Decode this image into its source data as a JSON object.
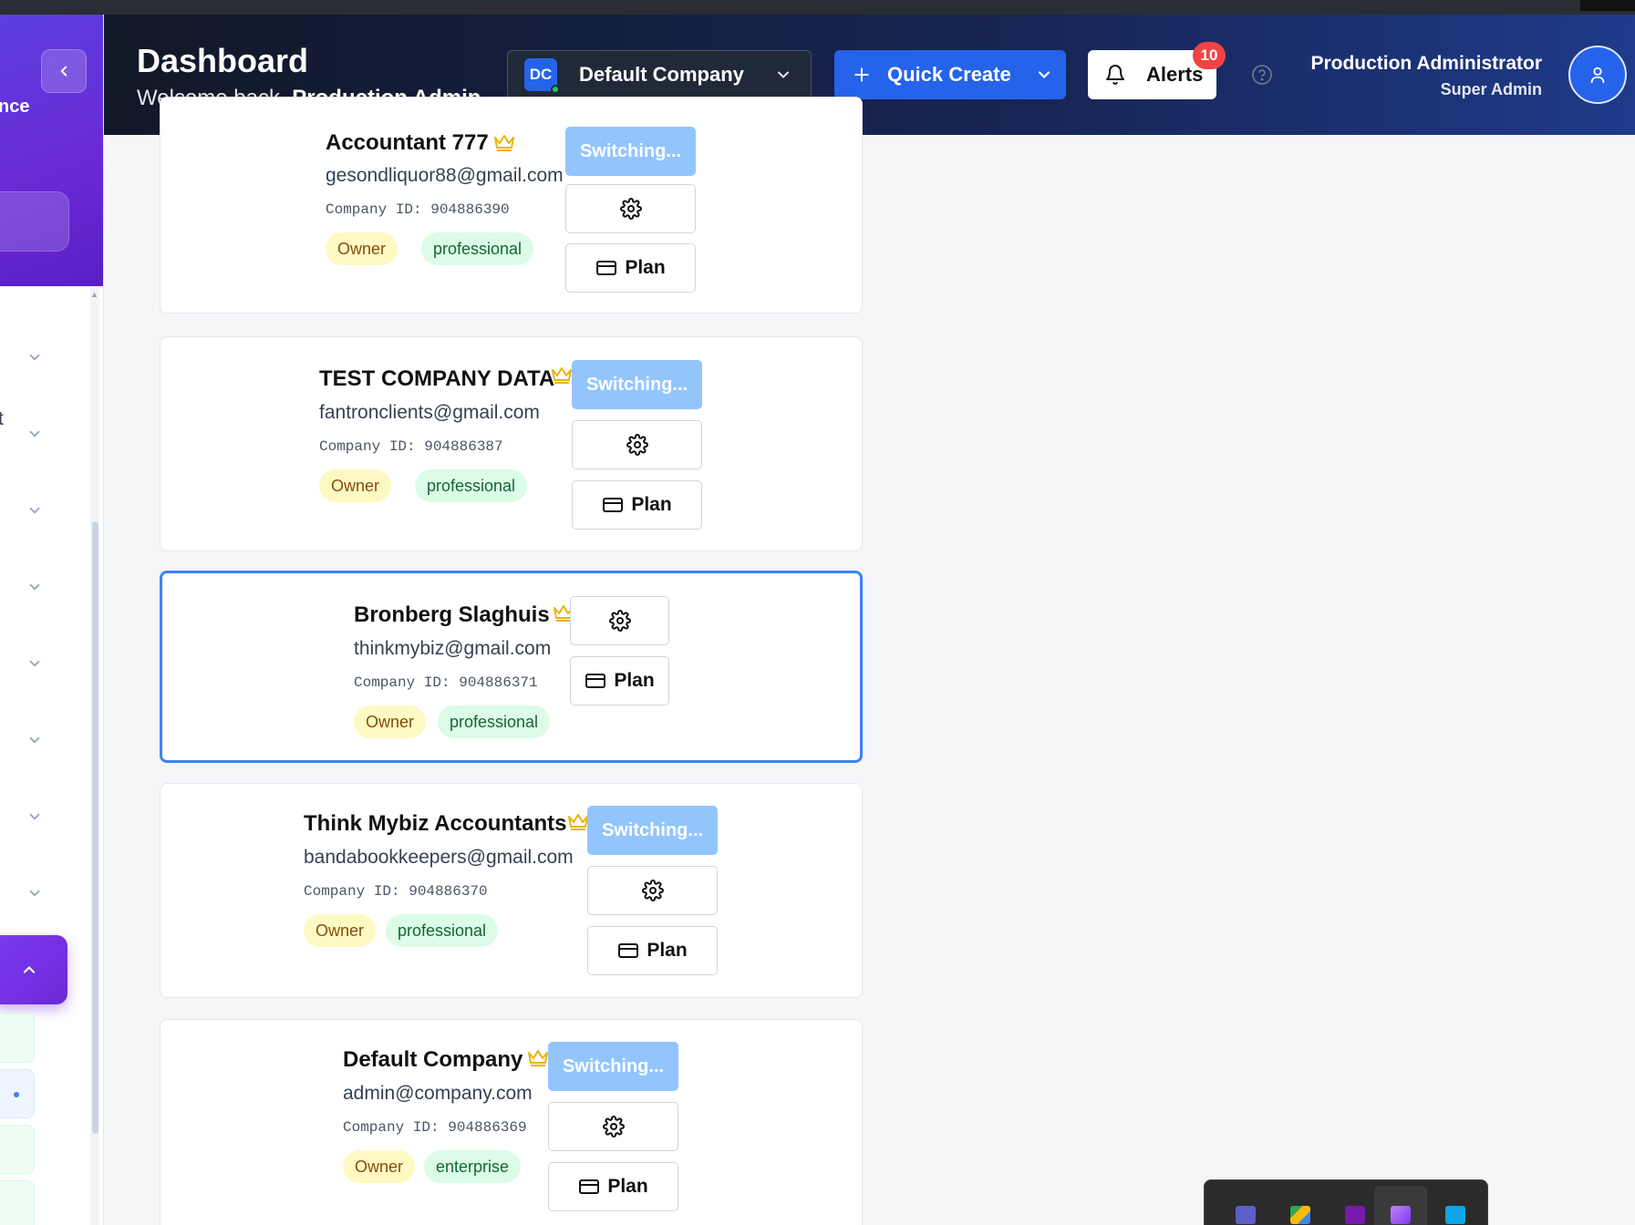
{
  "sidebar": {
    "title_partial": "nce",
    "item_partial": "t"
  },
  "header": {
    "title": "Dashboard",
    "welcome_prefix": "Welcome back, ",
    "welcome_name": "Production Admin...",
    "company_badge": "DC",
    "company_name": "Default Company",
    "quick_create_label": "Quick Create",
    "alerts_label": "Alerts",
    "alerts_count": "10",
    "user_name": "Production Administrator",
    "user_role": "Super Admin"
  },
  "cards": [
    {
      "name": "Accountant 777",
      "email": "gesondliquor88@gmail.com",
      "company_id": "Company ID: 904886390",
      "role": "Owner",
      "plan": "professional",
      "switch_label": "Switching...",
      "plan_button": "Plan"
    },
    {
      "name": "TEST COMPANY DATA",
      "email": "fantronclients@gmail.com",
      "company_id": "Company ID: 904886387",
      "role": "Owner",
      "plan": "professional",
      "switch_label": "Switching...",
      "plan_button": "Plan"
    },
    {
      "name": "Bronberg Slaghuis",
      "email": "thinkmybiz@gmail.com",
      "company_id": "Company ID: 904886371",
      "role": "Owner",
      "plan": "professional",
      "plan_button": "Plan",
      "selected": true
    },
    {
      "name": "Think Mybiz Accountants",
      "email": "bandabookkeepers@gmail.com",
      "company_id": "Company ID: 904886370",
      "role": "Owner",
      "plan": "professional",
      "switch_label": "Switching...",
      "plan_button": "Plan"
    },
    {
      "name": "Default Company",
      "email": "admin@company.com",
      "company_id": "Company ID: 904886369",
      "role": "Owner",
      "plan": "enterprise",
      "switch_label": "Switching...",
      "plan_button": "Plan"
    }
  ],
  "colors": {
    "accent": "#2563eb",
    "switching": "#93c5fd",
    "owner_badge": "#fef9c3",
    "plan_badge": "#dcfce7",
    "selected_border": "#3b82f6",
    "crown": "#eab308"
  },
  "icons": [
    "chevron-left-icon",
    "chevron-down-icon",
    "chevron-up-icon",
    "plus-icon",
    "bell-icon",
    "help-icon",
    "user-icon",
    "crown-icon",
    "gear-icon",
    "credit-card-icon"
  ]
}
